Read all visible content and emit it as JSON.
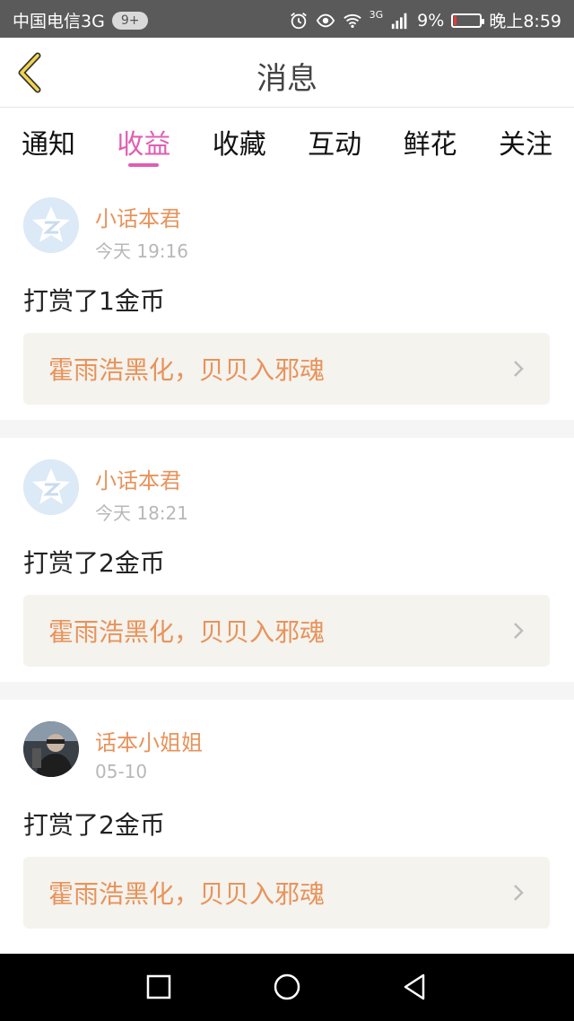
{
  "status_bar": {
    "carrier": "中国电信3G",
    "notif_badge": "9+",
    "signal_type": "3G",
    "battery": "9%",
    "time": "晚上8:59",
    "battery_level": 0.09
  },
  "header": {
    "title": "消息"
  },
  "tabs": [
    {
      "label": "通知",
      "active": false
    },
    {
      "label": "收益",
      "active": true
    },
    {
      "label": "收藏",
      "active": false
    },
    {
      "label": "互动",
      "active": false
    },
    {
      "label": "鲜花",
      "active": false
    },
    {
      "label": "关注",
      "active": false
    }
  ],
  "messages": [
    {
      "user": "小话本君",
      "time": "今天 19:16",
      "text": "打赏了1金币",
      "story": "霍雨浩黑化，贝贝入邪魂",
      "avatar": "default-avatar"
    },
    {
      "user": "小话本君",
      "time": "今天 18:21",
      "text": "打赏了2金币",
      "story": "霍雨浩黑化，贝贝入邪魂",
      "avatar": "default-avatar"
    },
    {
      "user": "话本小姐姐",
      "time": "05-10",
      "text": "打赏了2金币",
      "story": "霍雨浩黑化，贝贝入邪魂",
      "avatar": "photo-avatar"
    }
  ],
  "colors": {
    "accent": "#e05eb3",
    "name": "#e8935b",
    "link_bg": "#f4f3ee"
  }
}
